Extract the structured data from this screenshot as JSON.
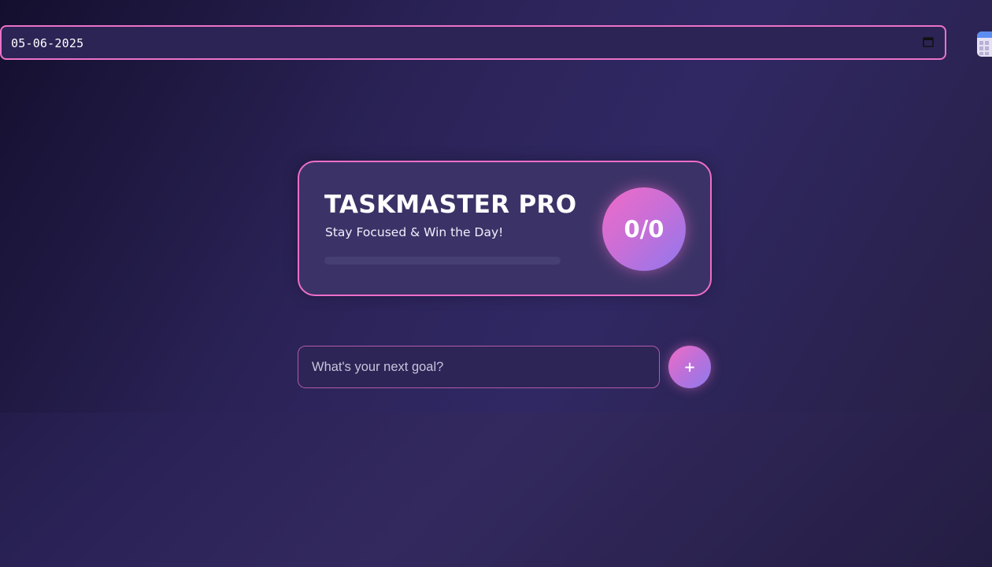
{
  "date_input": {
    "value": "05-06-2025",
    "picker_icon": "calendar-icon"
  },
  "calendar_app_icon": "calendar-app-icon",
  "header_card": {
    "title": "TASKMASTER PRO",
    "subtitle": "Stay Focused & Win the Day!",
    "progress": 0,
    "count": "0/0"
  },
  "new_task": {
    "placeholder": "What's your next goal?",
    "value": "",
    "add_label": "+"
  },
  "colors": {
    "accent_pink": "#ec72c8",
    "accent_purple": "#8f78ee",
    "background": "#2b2358"
  }
}
